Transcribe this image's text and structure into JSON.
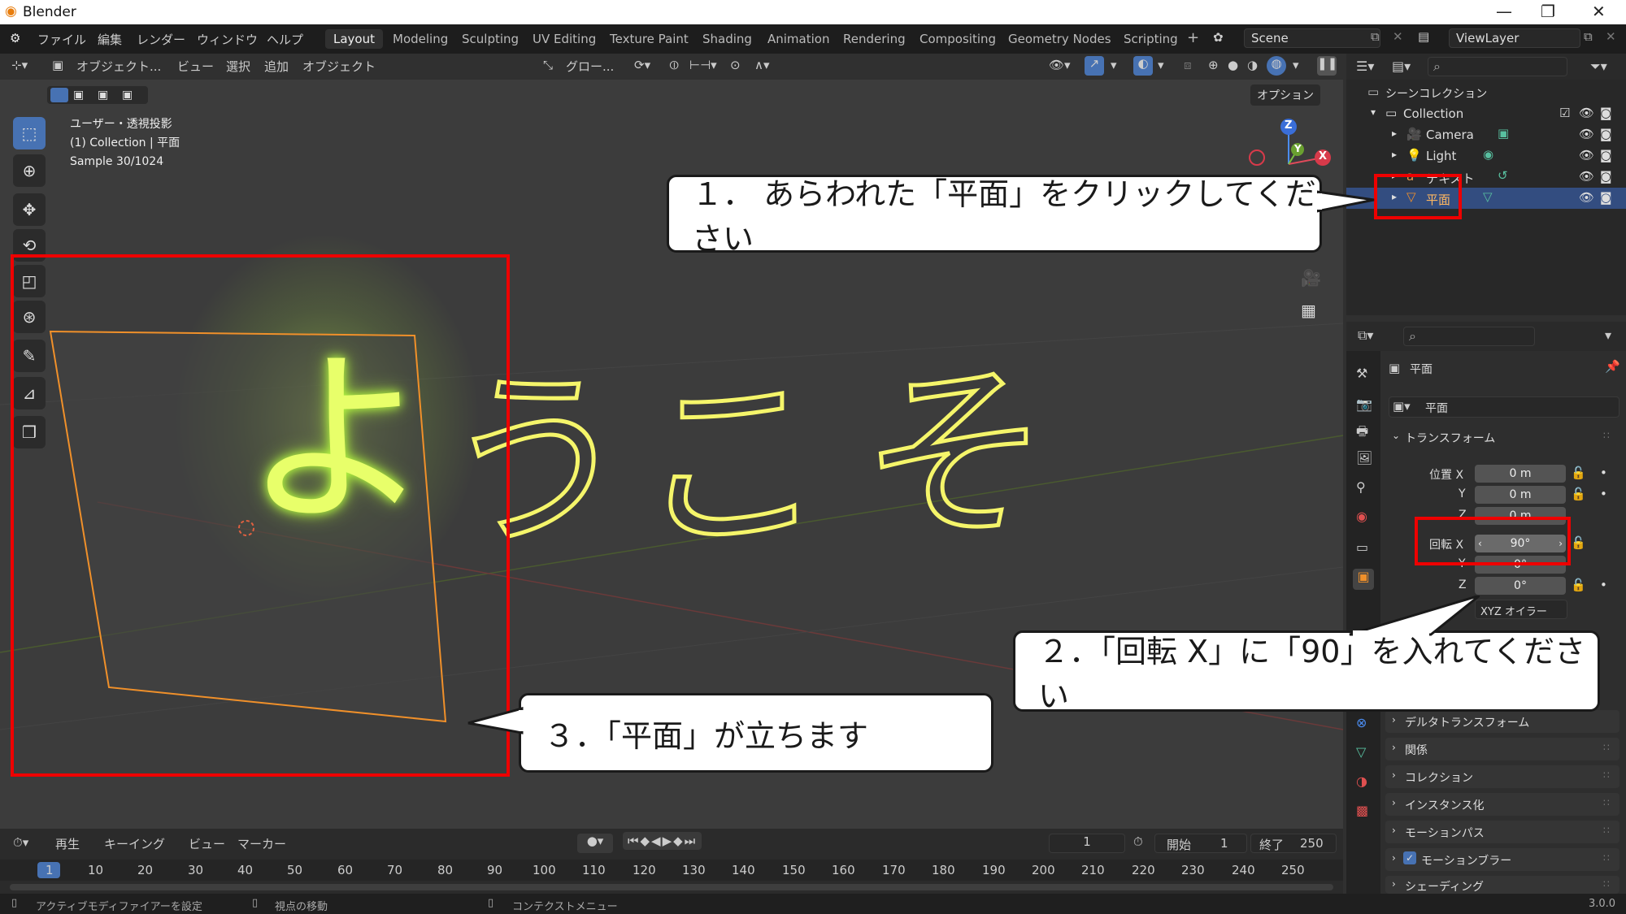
{
  "titlebar": {
    "title": "Blender",
    "minimize": "—",
    "maximize": "❐",
    "close": "✕"
  },
  "menus": [
    "ファイル",
    "編集",
    "レンダー",
    "ウィンドウ",
    "ヘルプ"
  ],
  "workspaces": [
    "Layout",
    "Modeling",
    "Sculpting",
    "UV Editing",
    "Texture Paint",
    "Shading",
    "Animation",
    "Rendering",
    "Compositing",
    "Geometry Nodes",
    "Scripting"
  ],
  "active_workspace": "Layout",
  "add_workspace": "+",
  "scene": "Scene",
  "view_layer": "ViewLayer",
  "viewport_header": {
    "mode": "オブジェクト...",
    "menus": [
      "ビュー",
      "選択",
      "追加",
      "オブジェクト"
    ],
    "transform_orientation": "グロー...",
    "options": "オプション"
  },
  "viewport_info": {
    "line1": "ユーザー・透視投影",
    "line2": "(1) Collection | 平面",
    "line3": "Sample 30/1024"
  },
  "viewport_text": [
    "よ",
    "う",
    "こ",
    "そ"
  ],
  "gizmo": {
    "x": "X",
    "y": "Y",
    "z": "Z"
  },
  "outliner": {
    "scene_collection": "シーンコレクション",
    "items": [
      {
        "label": "Collection",
        "level": 1
      },
      {
        "label": "Camera",
        "level": 2
      },
      {
        "label": "Light",
        "level": 2
      },
      {
        "label": "テキスト",
        "level": 2
      },
      {
        "label": "平面",
        "level": 2,
        "selected": true
      }
    ]
  },
  "properties": {
    "object_name": "平面",
    "object_field": "平面",
    "transform_header": "トランスフォーム",
    "location": {
      "label_x": "位置 X",
      "label_y": "Y",
      "label_z": "Z",
      "x": "0 m",
      "y": "0 m",
      "z": "0 m"
    },
    "rotation": {
      "label_x": "回転 X",
      "label_y": "Y",
      "label_z": "Z",
      "x": "90°",
      "y": "0°",
      "z": "0°"
    },
    "rotation_mode": "XYZ オイラー",
    "panels": [
      "デルタトランスフォーム",
      "関係",
      "コレクション",
      "インスタンス化",
      "モーションパス",
      "モーションブラー",
      "シェーディング"
    ]
  },
  "timeline": {
    "menus": [
      "再生",
      "キーイング",
      "ビュー",
      "マーカー"
    ],
    "current_frame": "1",
    "start_label": "開始",
    "start": "1",
    "end_label": "終了",
    "end": "250",
    "ticks": [
      "1",
      "10",
      "20",
      "30",
      "40",
      "50",
      "60",
      "70",
      "80",
      "90",
      "100",
      "110",
      "120",
      "130",
      "140",
      "150",
      "160",
      "170",
      "180",
      "190",
      "200",
      "210",
      "220",
      "230",
      "240",
      "250"
    ]
  },
  "statusbar": {
    "left": "アクティブモディファイアーを設定",
    "middle": "視点の移動",
    "right": "コンテクストメニュー",
    "version": "3.0.0"
  },
  "callouts": {
    "c1": "１．  あらわれた「平面」をクリックしてください",
    "c2": "２．「回転 X」に「90」を入れてください",
    "c3": "３．「平面」が立ちます"
  },
  "colors": {
    "highlight": "#ee0000",
    "accent": "#4772b3",
    "neon": "#e8f56a",
    "orange": "#f0902a"
  }
}
